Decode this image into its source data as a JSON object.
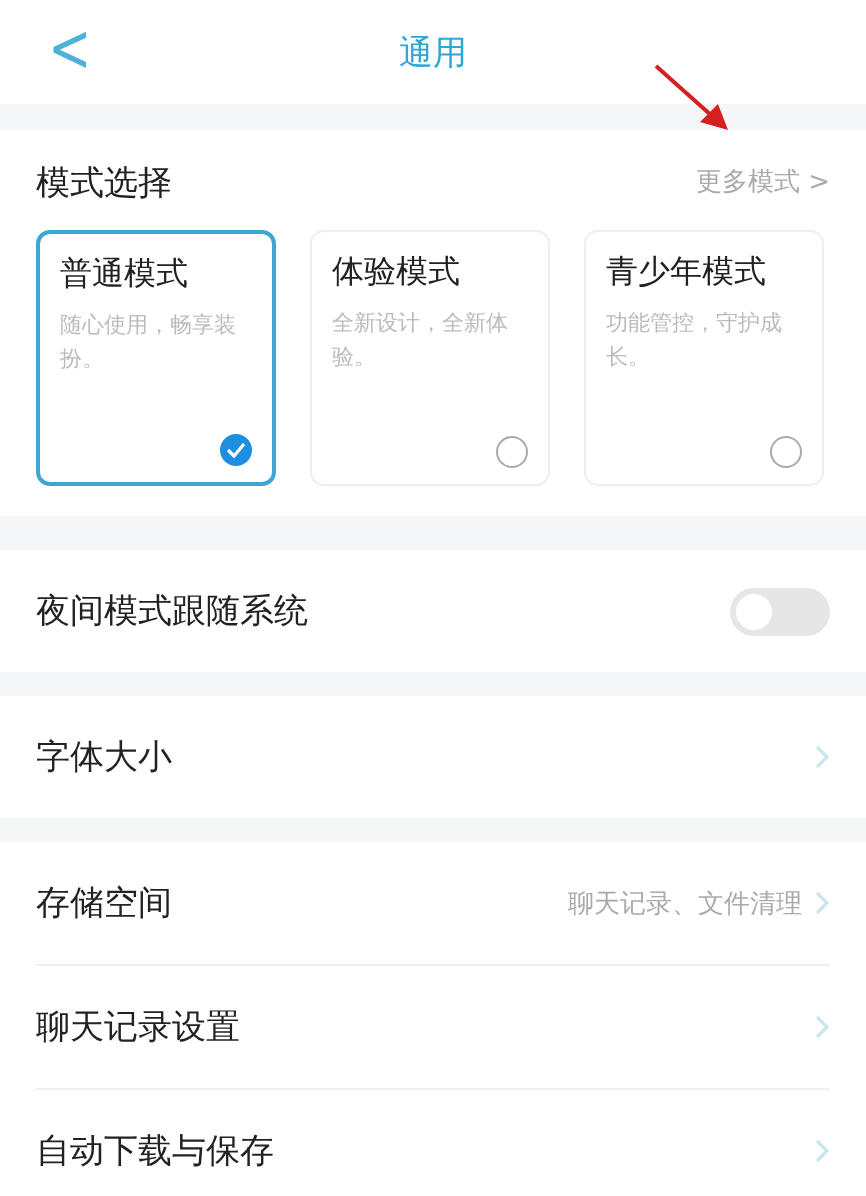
{
  "header": {
    "back": "<",
    "title": "通用"
  },
  "mode_section": {
    "title": "模式选择",
    "more": "更多模式 >",
    "modes": [
      {
        "name": "普通模式",
        "description": "随心使用，畅享装扮。",
        "selected": true
      },
      {
        "name": "体验模式",
        "description": "全新设计，全新体验。",
        "selected": false
      },
      {
        "name": "青少年模式",
        "description": "功能管控，守护成长。",
        "selected": false
      }
    ]
  },
  "groups": [
    [
      {
        "kind": "toggle",
        "label": "夜间模式跟随系统",
        "on": false
      }
    ],
    [
      {
        "kind": "link",
        "label": "字体大小"
      }
    ],
    [
      {
        "kind": "link",
        "label": "存储空间",
        "detail": "聊天记录、文件清理"
      },
      {
        "kind": "link",
        "label": "聊天记录设置"
      },
      {
        "kind": "link",
        "label": "自动下载与保存"
      }
    ]
  ]
}
